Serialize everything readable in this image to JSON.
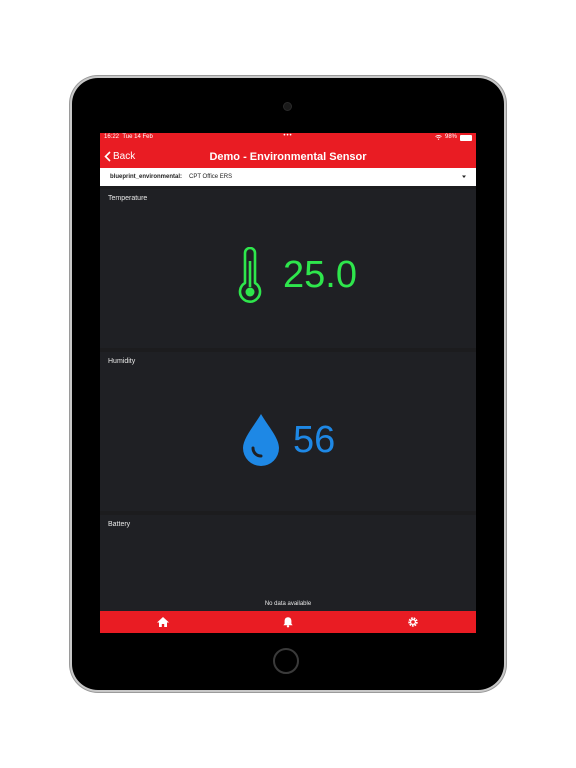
{
  "status": {
    "time": "16:22",
    "date": "Tue 14 Feb",
    "battery": "98%",
    "dots": "•••"
  },
  "nav": {
    "back_label": "Back",
    "title": "Demo - Environmental Sensor"
  },
  "selector": {
    "key": "blueprint_environmental:",
    "value": "CPT Office ERS"
  },
  "temperature": {
    "label": "Temperature",
    "value": "25.0",
    "color": "#2ee64c"
  },
  "humidity": {
    "label": "Humidity",
    "value": "56",
    "color": "#1e88e5"
  },
  "battery_card": {
    "label": "Battery",
    "message": "No data available"
  },
  "tabs": [
    "home-icon",
    "bell-icon",
    "gear-icon"
  ],
  "accent": "#e91c23"
}
